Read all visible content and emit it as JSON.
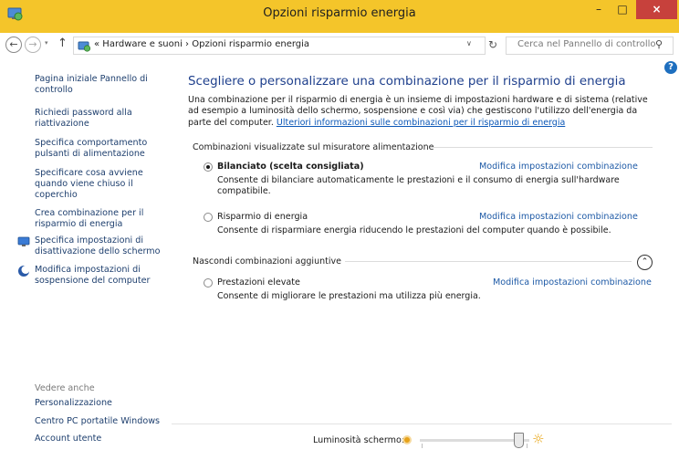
{
  "window": {
    "title": "Opzioni risparmio energia",
    "minimize_label": "–",
    "maximize_label": "□",
    "close_label": "×"
  },
  "nav": {
    "back_label": "←",
    "forward_label": "→",
    "recent_label": "▾",
    "up_label": "↑",
    "address": "« Hardware e suoni  ›  Opzioni risparmio energia",
    "dropdown_label": "∨",
    "refresh_label": "↻",
    "search_placeholder": "Cerca nel Pannello di controllo",
    "search_icon_label": "⚲"
  },
  "sidebar": {
    "items": [
      {
        "label": "Pagina iniziale Pannello di controllo"
      },
      {
        "label": "Richiedi password alla riattivazione"
      },
      {
        "label": "Specifica comportamento pulsanti di alimentazione"
      },
      {
        "label": "Specificare cosa avviene quando viene chiuso il coperchio"
      },
      {
        "label": "Crea combinazione per il risparmio di energia"
      },
      {
        "label": "Specifica impostazioni di disattivazione dello schermo"
      },
      {
        "label": "Modifica impostazioni di sospensione del computer"
      }
    ],
    "see_also_heading": "Vedere anche",
    "see_also": [
      {
        "label": "Personalizzazione"
      },
      {
        "label": "Centro PC portatile Windows"
      },
      {
        "label": "Account utente"
      }
    ]
  },
  "main": {
    "help_label": "?",
    "heading": "Scegliere o personalizzare una combinazione per il risparmio di energia",
    "description": "Una combinazione per il risparmio di energia è un insieme di impostazioni hardware e di sistema (relative ad esempio a luminosità dello schermo, sospensione e così via) che gestiscono l'utilizzo dell'energia da parte del computer. ",
    "description_link": "Ulteriori informazioni sulle combinazioni per il risparmio di energia",
    "section_shown": "Combinazioni visualizzate sul misuratore alimentazione",
    "section_hidden": "Nascondi combinazioni aggiuntive",
    "collapse_label": "⌃",
    "plans": [
      {
        "name": "Bilanciato (scelta consigliata)",
        "selected": true,
        "link": "Modifica impostazioni combinazione",
        "description": "Consente di bilanciare automaticamente le prestazioni e il consumo di energia sull'hardware compatibile."
      },
      {
        "name": "Risparmio di energia",
        "selected": false,
        "link": "Modifica impostazioni combinazione",
        "description": "Consente di risparmiare energia riducendo le prestazioni del computer quando è possibile."
      },
      {
        "name": "Prestazioni elevate",
        "selected": false,
        "link": "Modifica impostazioni combinazione",
        "description": "Consente di migliorare le prestazioni ma utilizza più energia."
      }
    ]
  },
  "brightness": {
    "label": "Luminosità schermo:",
    "level_percent": 90,
    "sun_label": "☼"
  },
  "colors": {
    "titlebar": "#f4c52a",
    "link": "#1e5aa6",
    "heading": "#1e3f8c",
    "close": "#c7413c"
  }
}
